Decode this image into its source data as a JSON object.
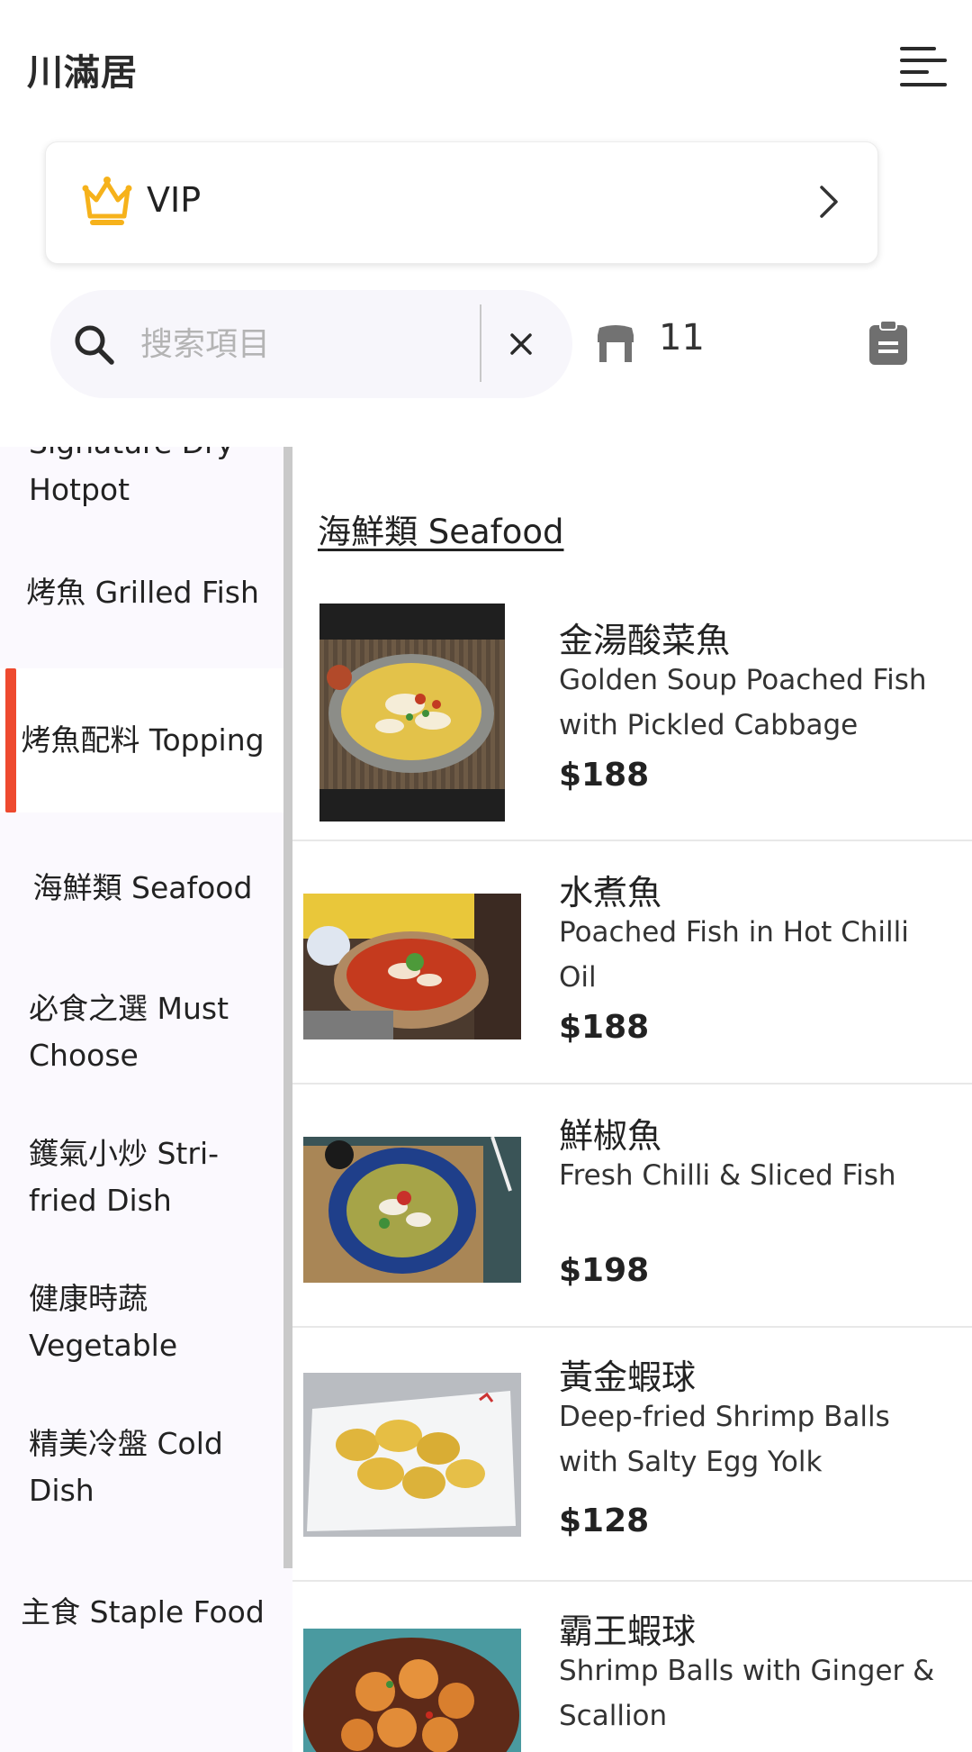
{
  "app": {
    "title": "川滿居"
  },
  "header": {
    "menu_icon": "hamburger-menu-icon"
  },
  "vip": {
    "label": "VIP",
    "icon": "crown-icon",
    "accent_color": "#f6b21b"
  },
  "search": {
    "placeholder": "搜索項目",
    "value": ""
  },
  "table": {
    "number": "11",
    "icon": "table-icon"
  },
  "colors": {
    "active_indicator": "#ee4a2f",
    "sidebar_bg": "#fbf9fe"
  },
  "sidebar": {
    "items": [
      {
        "label": "Signature Dry Hotpot",
        "active": false
      },
      {
        "label": "烤魚 Grilled Fish",
        "active": false
      },
      {
        "label": "烤魚配料 Topping",
        "active": true
      },
      {
        "label": "海鮮類 Seafood",
        "active": false
      },
      {
        "label": "必食之選 Must Choose",
        "active": false
      },
      {
        "label": "鑊氣小炒 Stri-fried Dish",
        "active": false
      },
      {
        "label": "健康時蔬 Vegetable",
        "active": false
      },
      {
        "label": "精美冷盤 Cold Dish",
        "active": false
      },
      {
        "label": "主食 Staple Food",
        "active": false
      }
    ]
  },
  "section": {
    "title": "海鮮類 Seafood"
  },
  "dishes": [
    {
      "name_zh": "金湯酸菜魚",
      "name_en": "Golden Soup Poached Fish with Pickled Cabbage",
      "price": "$188"
    },
    {
      "name_zh": "水煮魚",
      "name_en": "Poached Fish in Hot Chilli Oil",
      "price": "$188"
    },
    {
      "name_zh": "鮮椒魚",
      "name_en": "Fresh Chilli & Sliced Fish",
      "price": "$198"
    },
    {
      "name_zh": "黃金蝦球",
      "name_en": "Deep-fried Shrimp Balls with Salty Egg Yolk",
      "price": "$128"
    },
    {
      "name_zh": "霸王蝦球",
      "name_en": "Shrimp Balls with Ginger & Scallion",
      "price": ""
    }
  ]
}
